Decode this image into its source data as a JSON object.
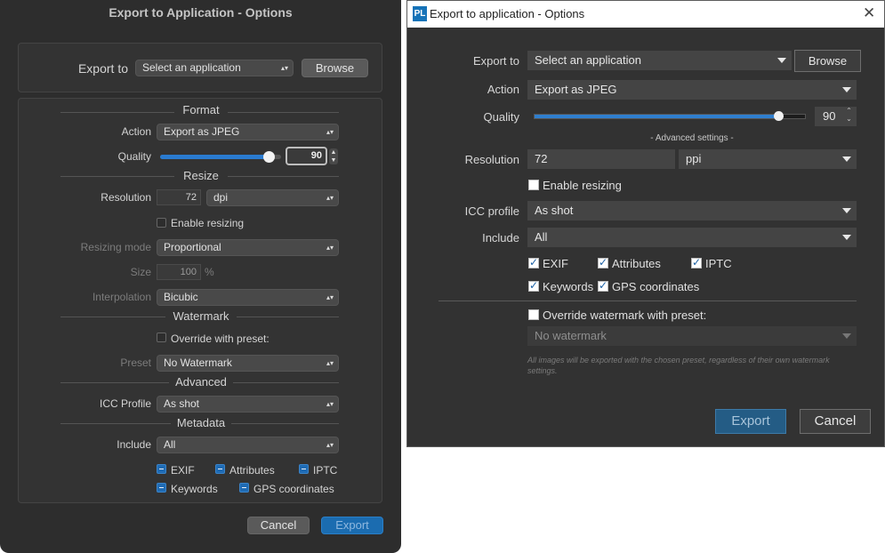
{
  "mac": {
    "title": "Export to Application - Options",
    "export_to_label": "Export to",
    "export_to_value": "Select an application",
    "browse_label": "Browse",
    "format_header": "Format",
    "action_label": "Action",
    "action_value": "Export as JPEG",
    "quality_label": "Quality",
    "quality_value": "90",
    "quality_level": 0.9,
    "resize_header": "Resize",
    "resolution_label": "Resolution",
    "resolution_value": "72",
    "resolution_unit": "dpi",
    "enable_resizing_label": "Enable resizing",
    "resizing_mode_label": "Resizing mode",
    "resizing_mode_value": "Proportional",
    "size_label": "Size",
    "size_value": "100",
    "size_unit": "%",
    "interpolation_label": "Interpolation",
    "interpolation_value": "Bicubic",
    "watermark_header": "Watermark",
    "override_label": "Override with preset:",
    "preset_label": "Preset",
    "preset_value": "No Watermark",
    "advanced_header": "Advanced",
    "icc_label": "ICC Profile",
    "icc_value": "As shot",
    "metadata_header": "Metadata",
    "include_label": "Include",
    "include_value": "All",
    "exif_label": "EXIF",
    "attributes_label": "Attributes",
    "iptc_label": "IPTC",
    "keywords_label": "Keywords",
    "gps_label": "GPS coordinates",
    "cancel_label": "Cancel",
    "export_label": "Export"
  },
  "win": {
    "logo_text": "PL",
    "title": "Export to application - Options",
    "close_glyph": "✕",
    "export_to_label": "Export to",
    "export_to_value": "Select an application",
    "browse_label": "Browse",
    "action_label": "Action",
    "action_value": "Export as JPEG",
    "quality_label": "Quality",
    "quality_value": "90",
    "quality_level": 0.9,
    "spinner_glyph": "⌃⌄",
    "advanced_settings": "- Advanced settings -",
    "resolution_label": "Resolution",
    "resolution_value": "72",
    "resolution_unit": "ppi",
    "enable_resizing_label": "Enable resizing",
    "icc_label": "ICC profile",
    "icc_value": "As shot",
    "include_label": "Include",
    "include_value": "All",
    "exif_label": "EXIF",
    "attributes_label": "Attributes",
    "iptc_label": "IPTC",
    "keywords_label": "Keywords",
    "gps_label": "GPS coordinates",
    "override_label": "Override watermark with preset:",
    "watermark_value": "No watermark",
    "watermark_note": "All images will be exported with the chosen preset, regardless of their own watermark settings.",
    "export_label": "Export",
    "cancel_label": "Cancel"
  }
}
